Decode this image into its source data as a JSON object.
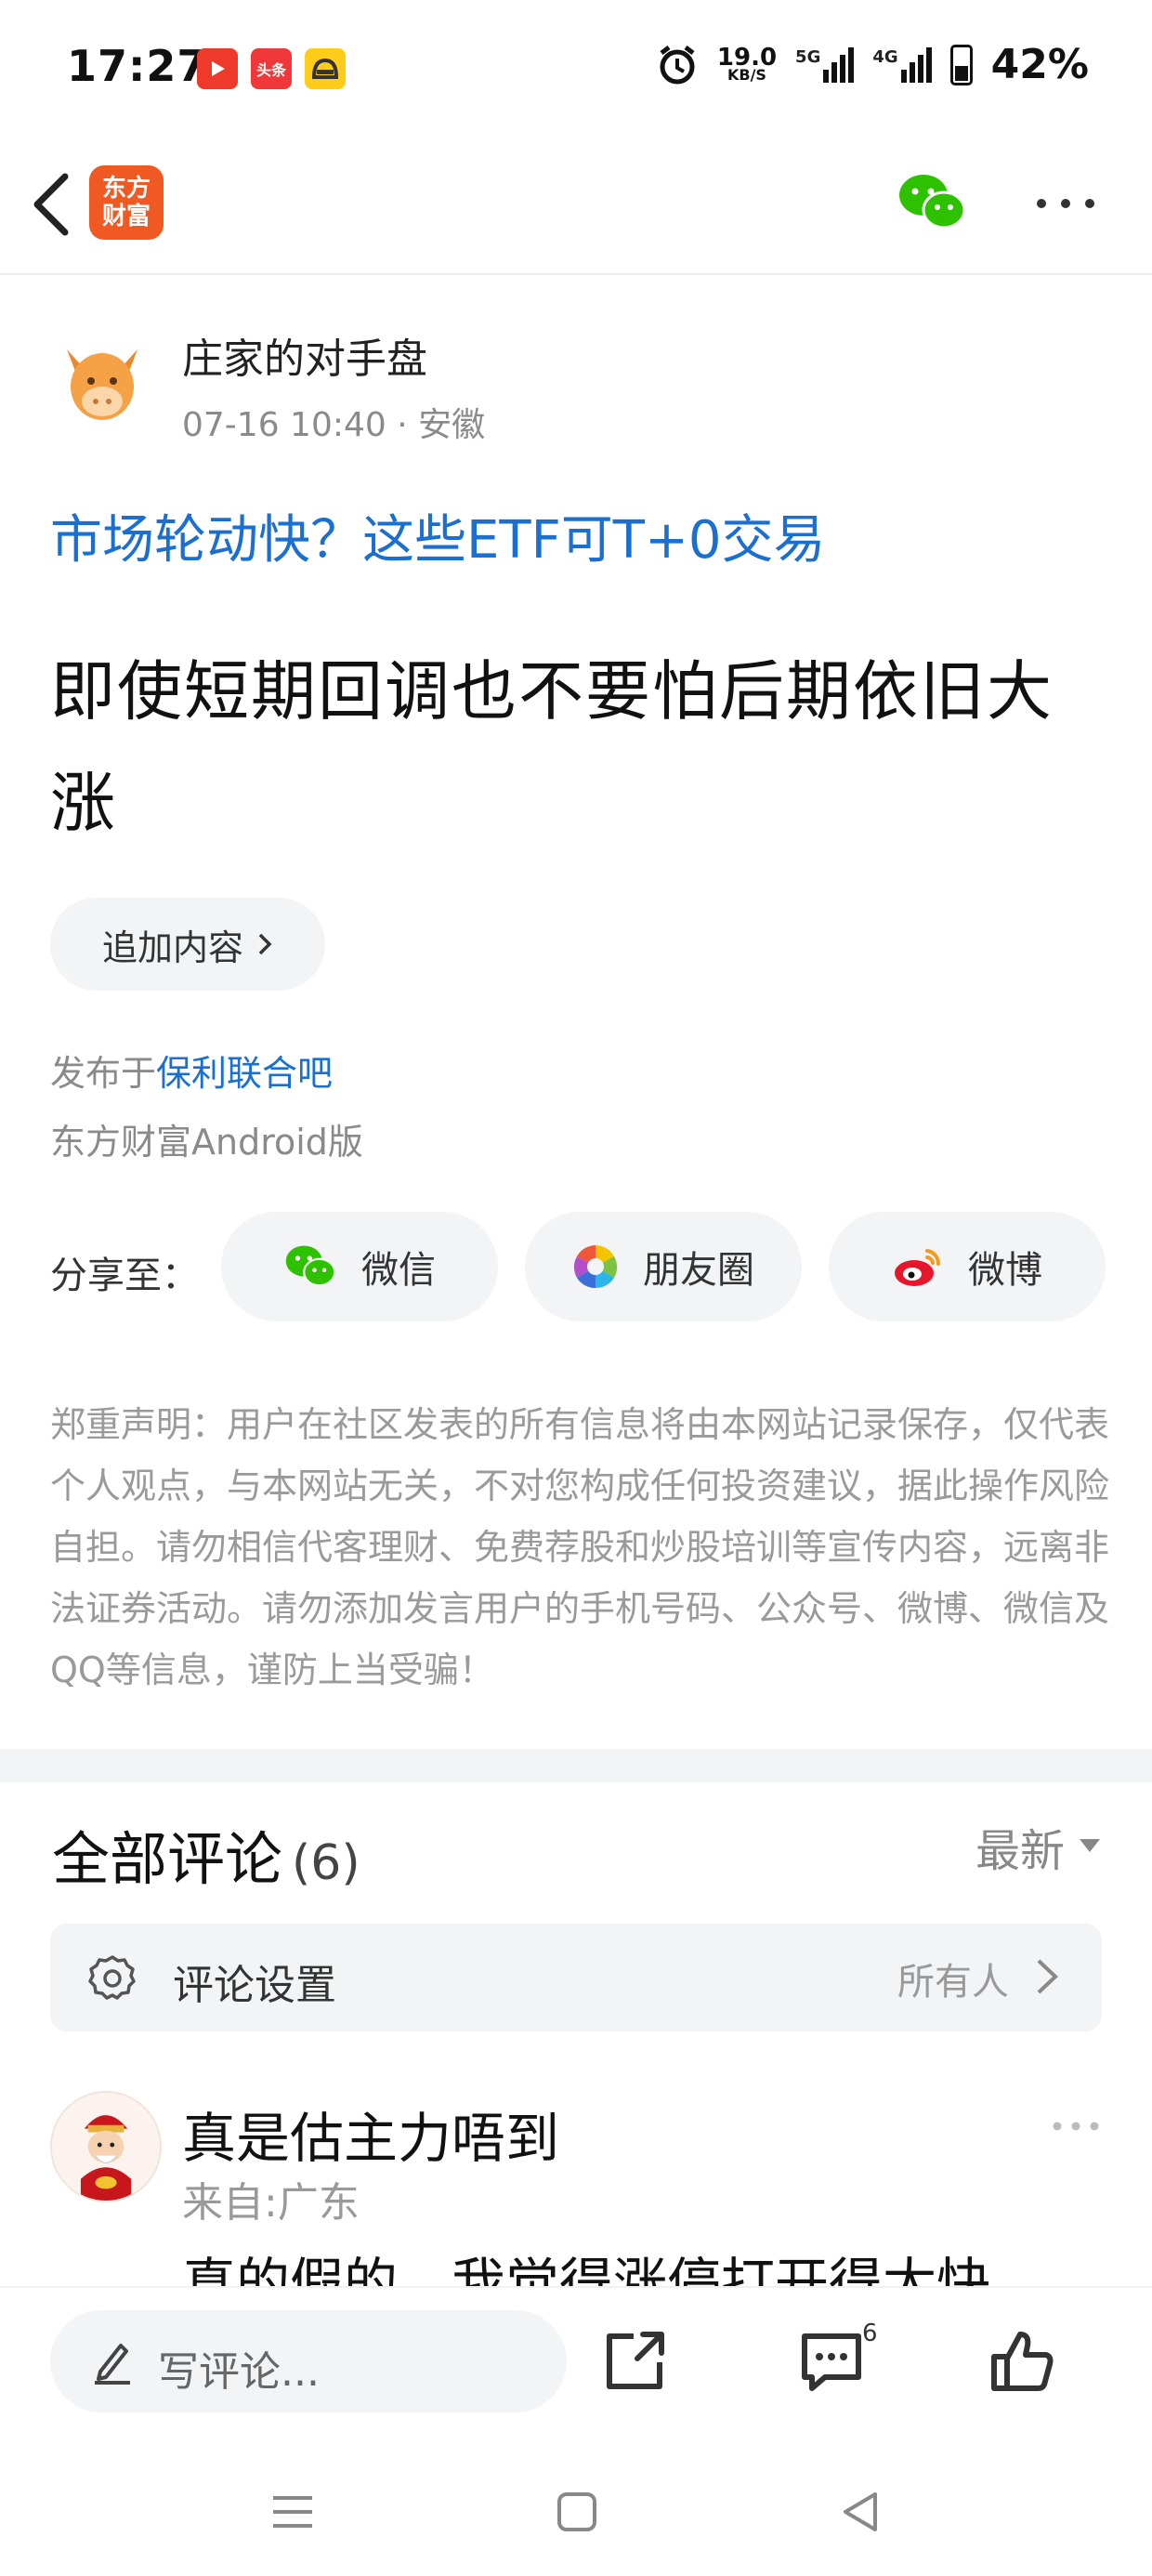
{
  "status_bar": {
    "time": "17:27",
    "notif_toutiao": "头条",
    "speed_value": "19.0",
    "speed_unit": "KB/S",
    "net1": "5G",
    "net2": "4G",
    "battery": "42%"
  },
  "header": {
    "app_logo_line1": "东方",
    "app_logo_line2": "财富"
  },
  "post": {
    "author": "庄家的对手盘",
    "meta": "07-16 10:40 · 安徽",
    "topic": "市场轮动快？这些ETF可T+0交易",
    "title": "即使短期回调也不要怕后期依旧大涨",
    "append_label": "追加内容",
    "published_prefix": "发布于",
    "published_bar": "保利联合吧",
    "client": "东方财富Android版"
  },
  "share": {
    "label": "分享至：",
    "wechat": "微信",
    "moments": "朋友圈",
    "weibo": "微博"
  },
  "disclaimer": "郑重声明：用户在社区发表的所有信息将由本网站记录保存，仅代表个人观点，与本网站无关，不对您构成任何投资建议，据此操作风险自担。请勿相信代客理财、免费荐股和炒股培训等宣传内容，远离非法证券活动。请勿添加发言用户的手机号码、公众号、微博、微信及QQ等信息，谨防上当受骗！",
  "comments": {
    "title": "全部评论",
    "count": "(6)",
    "sort": "最新",
    "settings_label": "评论设置",
    "settings_value": "所有人",
    "items": [
      {
        "user": "真是估主力唔到",
        "location": "来自:广东",
        "text": "真的假的，我觉得涨停打开得太快"
      }
    ]
  },
  "bottom_bar": {
    "write_placeholder": "写评论...",
    "comment_badge": "6"
  },
  "colors": {
    "link_blue": "#1a6fd0",
    "brand_orange": "#f05a22",
    "wechat_green": "#2dc100"
  }
}
